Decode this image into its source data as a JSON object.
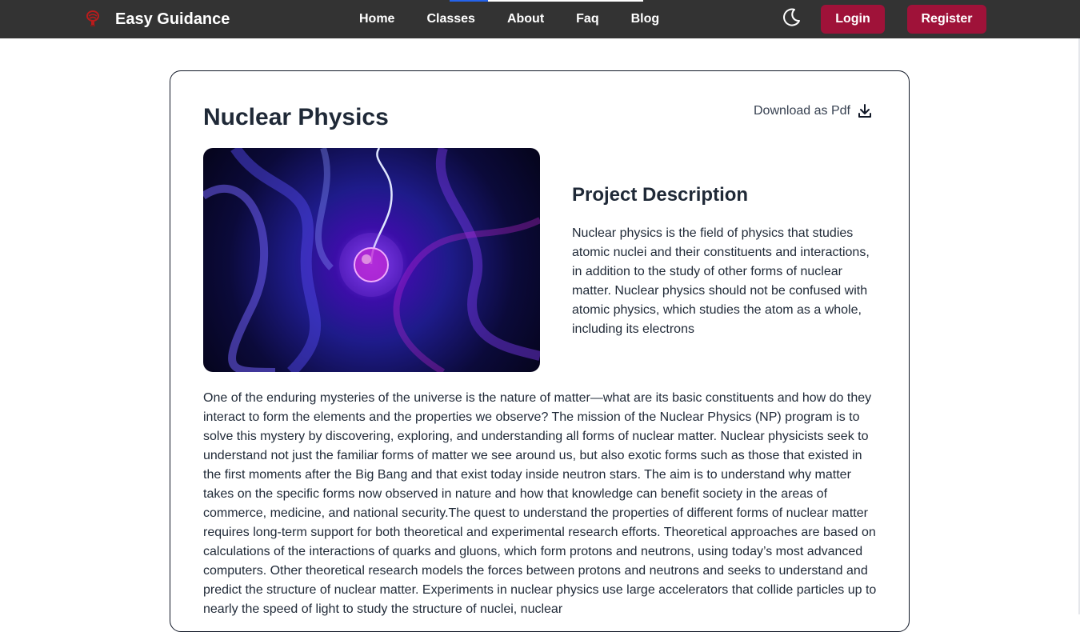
{
  "nav": {
    "brand": "Easy Guidance",
    "links": [
      "Home",
      "Classes",
      "About",
      "Faq",
      "Blog"
    ],
    "login_label": "Login",
    "register_label": "Register",
    "theme_icon": "moon-icon",
    "scroll_progress": 0.2
  },
  "colors": {
    "navbar_bg": "#333333",
    "accent_button": "#9f1239",
    "text": "#1f2937"
  },
  "page": {
    "title": "Nuclear Physics",
    "download_label": "Download as Pdf",
    "download_icon": "download-icon",
    "description_title": "Project Description",
    "description_text": "Nuclear physics is the field of physics that studies atomic nuclei and their constituents and interactions, in addition to the study of other forms of nuclear matter. Nuclear physics should not be confused with atomic physics, which studies the atom as a whole, including its electrons",
    "body_text": "One of the enduring mysteries of the universe is the nature of matter—what are its basic constituents and how do they interact to form the elements and the properties we observe? The mission of the Nuclear Physics (NP) program is to solve this mystery by discovering, exploring, and understanding all forms of nuclear matter. Nuclear physicists seek to understand not just the familiar forms of matter we see around us, but also exotic forms such as those that existed in the first moments after the Big Bang and that exist today inside neutron stars. The aim is to understand why matter takes on the specific forms now observed in nature and how that knowledge can benefit society in the areas of commerce, medicine, and national security.The quest to understand the properties of different forms of nuclear matter requires long-term support for both theoretical and experimental research efforts. Theoretical approaches are based on calculations of the interactions of quarks and gluons, which form protons and neutrons, using today’s most advanced computers. Other theoretical research models the forces between protons and neutrons and seeks to understand and predict the structure of nuclear matter. Experiments in nuclear physics use large accelerators that collide particles up to nearly the speed of light to study the structure of nuclei, nuclear"
  }
}
